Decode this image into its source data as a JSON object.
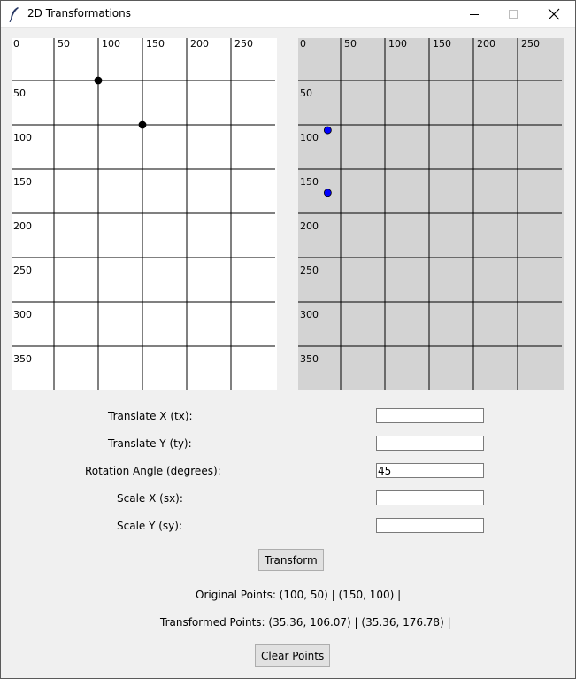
{
  "window": {
    "title": "2D Transformations",
    "icon": "feather-icon",
    "controls": [
      "minimize-icon",
      "maximize-icon",
      "close-icon"
    ]
  },
  "original_canvas": {
    "background": "#ffffff",
    "x_ticks": [
      "0",
      "50",
      "100",
      "150",
      "200",
      "250"
    ],
    "y_ticks": [
      "50",
      "100",
      "150",
      "200",
      "250",
      "300",
      "350"
    ],
    "points": [
      {
        "x": 100,
        "y": 50
      },
      {
        "x": 150,
        "y": 100
      }
    ],
    "point_color": "#000000"
  },
  "transformed_canvas": {
    "background": "#d3d3d3",
    "x_ticks": [
      "0",
      "50",
      "100",
      "150",
      "200",
      "250"
    ],
    "y_ticks": [
      "50",
      "100",
      "150",
      "200",
      "250",
      "300",
      "350"
    ],
    "points": [
      {
        "x": 35.36,
        "y": 106.07
      },
      {
        "x": 35.36,
        "y": 176.78
      }
    ],
    "point_color": "#0000ff"
  },
  "form": {
    "tx_label": "Translate X (tx):",
    "tx_value": "",
    "ty_label": "Translate Y (ty):",
    "ty_value": "",
    "angle_label": "Rotation Angle (degrees):",
    "angle_value": "45",
    "sx_label": "Scale X (sx):",
    "sx_value": "",
    "sy_label": "Scale Y (sy):",
    "sy_value": ""
  },
  "buttons": {
    "transform": "Transform",
    "clear": "Clear Points"
  },
  "output": {
    "original_points": "Original Points: (100, 50)  |  (150, 100)  |",
    "transformed_points": "Transformed Points: (35.36, 106.07)  |  (35.36, 176.78)  |"
  }
}
